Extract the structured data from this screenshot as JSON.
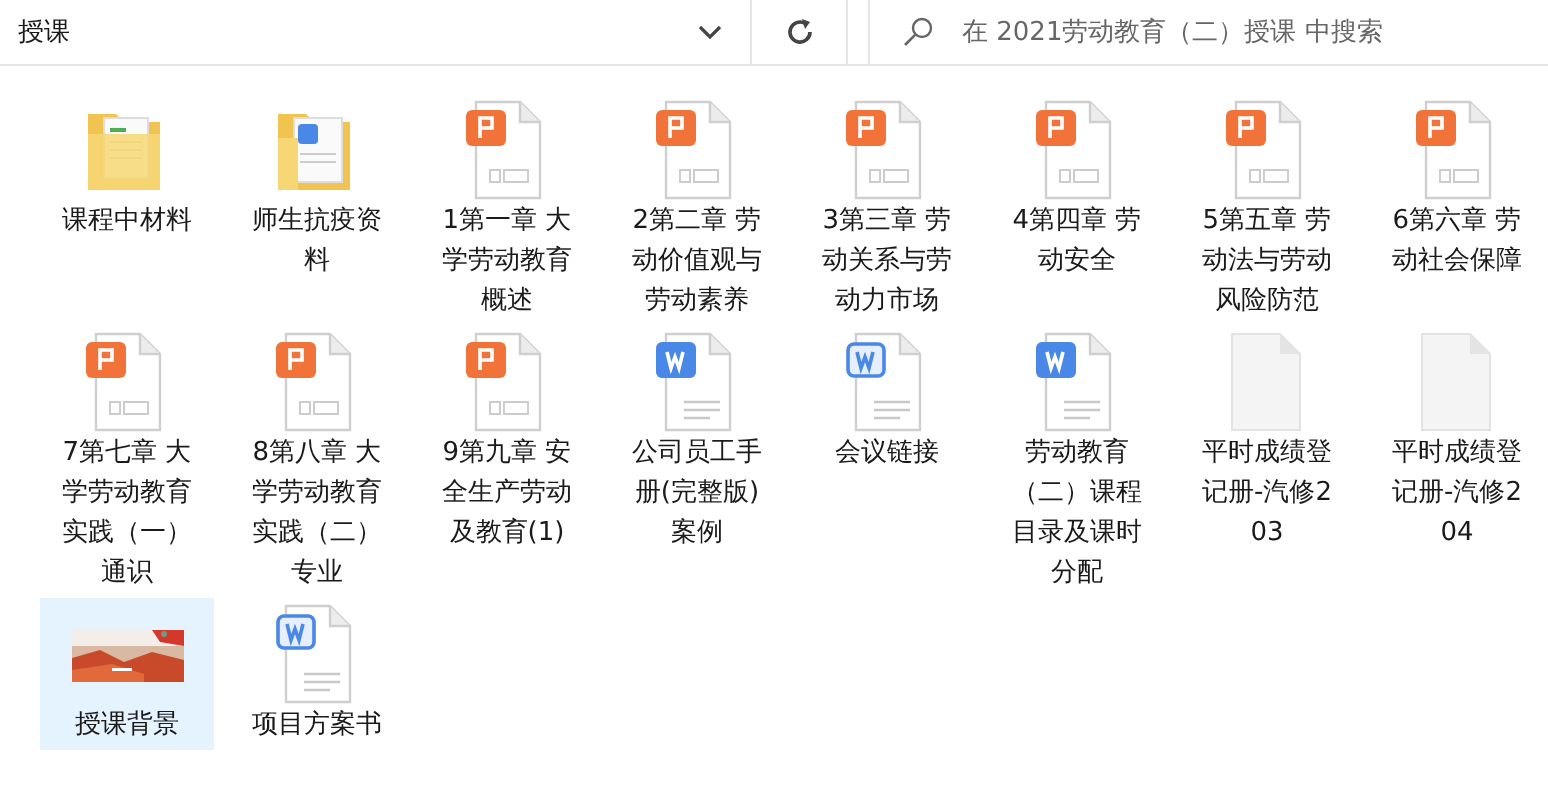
{
  "address_bar": {
    "value": "授课"
  },
  "search": {
    "placeholder": "在 2021劳动教育（二）授课 中搜索"
  },
  "items": [
    {
      "name": "课程中材料",
      "kind": "folder-sheet",
      "selected": false
    },
    {
      "name": "师生抗疫资料",
      "kind": "folder-doc",
      "selected": false
    },
    {
      "name": "1第一章 大学劳动教育概述",
      "kind": "ppt",
      "selected": false
    },
    {
      "name": "2第二章 劳动价值观与劳动素养",
      "kind": "ppt",
      "selected": false
    },
    {
      "name": "3第三章 劳动关系与劳动力市场",
      "kind": "ppt",
      "selected": false
    },
    {
      "name": "4第四章 劳动安全",
      "kind": "ppt",
      "selected": false
    },
    {
      "name": "5第五章 劳动法与劳动风险防范",
      "kind": "ppt",
      "selected": false
    },
    {
      "name": "6第六章 劳动社会保障",
      "kind": "ppt",
      "selected": false
    },
    {
      "name": "7第七章 大学劳动教育实践（一）通识",
      "kind": "ppt",
      "selected": false
    },
    {
      "name": "8第八章 大学劳动教育实践（二）专业",
      "kind": "ppt",
      "selected": false
    },
    {
      "name": "9第九章 安全生产劳动及教育(1)",
      "kind": "ppt",
      "selected": false
    },
    {
      "name": "公司员工手册(完整版)案例",
      "kind": "doc",
      "selected": false
    },
    {
      "name": "会议链接",
      "kind": "doc-outline",
      "selected": false
    },
    {
      "name": "劳动教育（二）课程目录及课时分配",
      "kind": "doc",
      "selected": false
    },
    {
      "name": "平时成绩登记册-汽修203",
      "kind": "blank",
      "selected": false
    },
    {
      "name": "平时成绩登记册-汽修204",
      "kind": "blank",
      "selected": false
    },
    {
      "name": "授课背景",
      "kind": "picture",
      "selected": true
    },
    {
      "name": "项目方案书",
      "kind": "doc-outline",
      "selected": false
    }
  ]
}
